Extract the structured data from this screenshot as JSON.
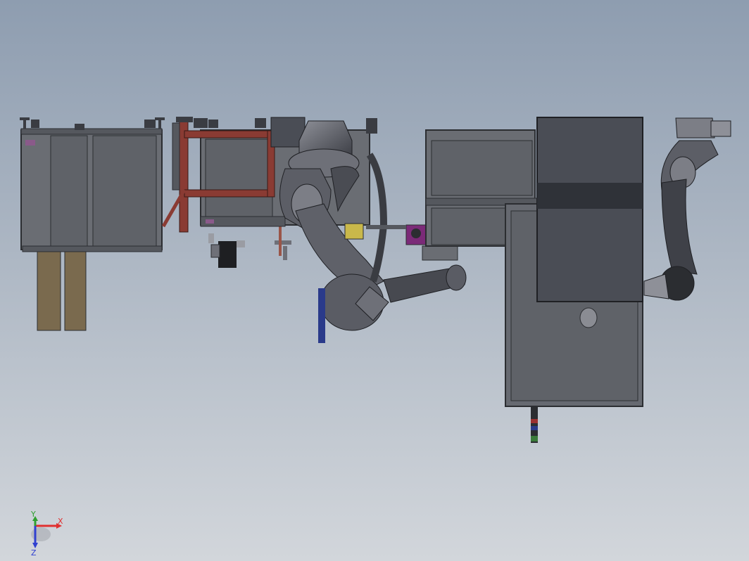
{
  "viewport": {
    "background_top": "#8e9db0",
    "background_bottom": "#d2d6db"
  },
  "colors": {
    "panel_gray": "#6a6d73",
    "panel_edge": "#2b2d31",
    "cabinet_dark": "#4a4d55",
    "cabinet_band": "#2f3238",
    "frame_red": "#8a3b33",
    "wood": "#7a6a4e",
    "robot_dark": "#3a3c42",
    "robot_mid": "#6e7078",
    "robot_light": "#9a9ca3",
    "accent_purple": "#7b2a78",
    "accent_yellow": "#c9b84a",
    "accent_blue": "#2a3a8a"
  },
  "triad": {
    "x_label": "X",
    "y_label": "Y",
    "z_label": "Z",
    "x_color": "#e03030",
    "y_color": "#30a030",
    "z_color": "#3040d0"
  }
}
